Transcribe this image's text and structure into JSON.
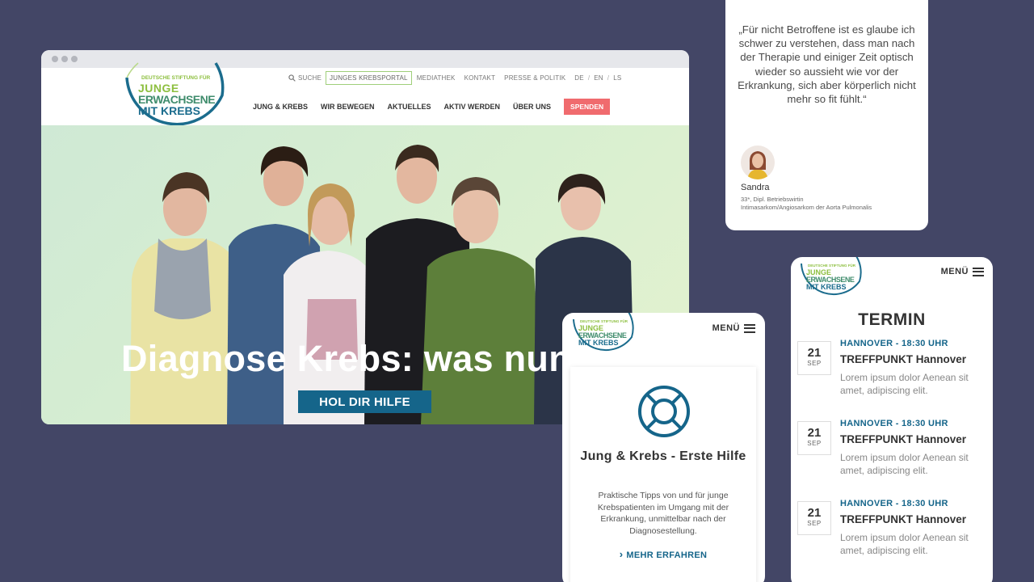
{
  "desktop": {
    "header": {
      "logo": {
        "line1": "DEUTSCHE STIFTUNG FÜR",
        "line2": "JUNGE",
        "line3": "ERWACHSENE",
        "line4": "MIT KREBS"
      },
      "util_nav": {
        "search": "SUCHE",
        "portal": "JUNGES KREBSPORTAL",
        "media": "MEDIATHEK",
        "contact": "KONTAKT",
        "press": "PRESSE & POLITIK",
        "lang_de": "DE",
        "lang_en": "EN",
        "lang_ls": "LS"
      },
      "main_nav": [
        "JUNG & KREBS",
        "WIR BEWEGEN",
        "AKTUELLES",
        "AKTIV WERDEN",
        "ÜBER UNS"
      ],
      "donate": "SPENDEN"
    },
    "hero": {
      "title": "Diagnose Krebs: was nun?",
      "button": "HOL DIR HILFE"
    }
  },
  "quote": {
    "text": "„Für nicht Betroffene ist es glaube ich schwer zu verstehen, dass man nach der Therapie und einiger Zeit optisch wieder so aussieht wie vor der Erkrankung, sich aber körperlich nicht mehr so fit fühlt.“",
    "name": "Sandra",
    "meta1": "33*, Dipl. Betriebswirtin",
    "meta2": "Intimasarkom/Angiosarkom der Aorta Pulmonalis"
  },
  "mobile_help": {
    "menu": "MENÜ",
    "title": "Jung & Krebs - Erste Hilfe",
    "text": "Praktische Tipps von und für junge Krebspatienten im Umgang mit der Erkrankung, unmittelbar nach der Diagnosestellung.",
    "link": "MEHR ERFAHREN"
  },
  "mobile_termin": {
    "menu": "MENÜ",
    "title": "TERMIN",
    "events": [
      {
        "day": "21",
        "month": "SEP",
        "location": "HANNOVER  -  18:30 UHR",
        "name": "TREFFPUNKT Hannover",
        "desc": "Lorem ipsum dolor Aenean sit amet, adipiscing elit."
      },
      {
        "day": "21",
        "month": "SEP",
        "location": "HANNOVER  -  18:30 UHR",
        "name": "TREFFPUNKT Hannover",
        "desc": "Lorem ipsum dolor Aenean sit amet, adipiscing elit."
      },
      {
        "day": "21",
        "month": "SEP",
        "location": "HANNOVER  -  18:30 UHR",
        "name": "TREFFPUNKT Hannover",
        "desc": "Lorem ipsum dolor Aenean sit amet, adipiscing elit."
      }
    ]
  },
  "colors": {
    "background": "#434666",
    "brand_blue": "#15658a",
    "donate": "#f06b6e",
    "logo_green": "#8dbf3f"
  }
}
